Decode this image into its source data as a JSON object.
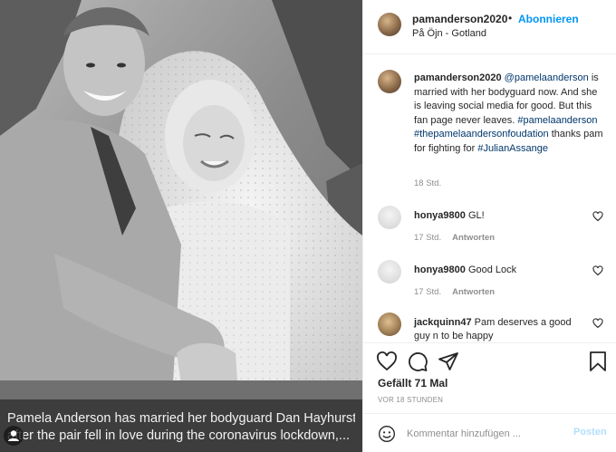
{
  "post": {
    "overlay_caption": {
      "line1": "Pamela Anderson has married her bodyguard Dan Hayhurst",
      "line2": "after the pair fell in love during the coronavirus lockdown,..."
    }
  },
  "header": {
    "username": "pamanderson2020",
    "separator": "•",
    "follow_label": "Abonnieren",
    "location": "På Öjn - Gotland",
    "more_label": "···"
  },
  "caption": {
    "username": "pamanderson2020",
    "mention": "@pamelaanderson",
    "text1": "is married with her bodyguard now. And she is leaving social media for good. But this fan page never leaves.",
    "hashtag1": "#pamelaanderson",
    "hashtag2": "#thepamelaandersonfoudation",
    "text2": "thanks pam for fighting for",
    "hashtag3": "#JulianAssange",
    "time": "18 Std."
  },
  "comments": [
    {
      "username": "honya9800",
      "text": "GL!",
      "time": "17 Std.",
      "reply": "Antworten"
    },
    {
      "username": "honya9800",
      "text": "Good Lock",
      "time": "17 Std.",
      "reply": "Antworten"
    },
    {
      "username": "jackquinn47",
      "text": "Pam deserves a good guy n to be happy",
      "time": "",
      "reply": ""
    }
  ],
  "actions": {
    "likes": "Gefällt 71 Mal",
    "ago": "VOR 18 STUNDEN",
    "comment_placeholder": "Kommentar hinzufügen ...",
    "post_label": "Posten"
  },
  "colors": {
    "accent": "#0095f6",
    "link": "#00376b",
    "muted": "#8e8e8e",
    "post_disabled": "#b2dffc"
  },
  "icons": {
    "like": "heart-icon",
    "comment": "comment-icon",
    "share": "share-icon",
    "save": "bookmark-icon",
    "emoji": "emoji-icon",
    "more": "more-icon"
  }
}
